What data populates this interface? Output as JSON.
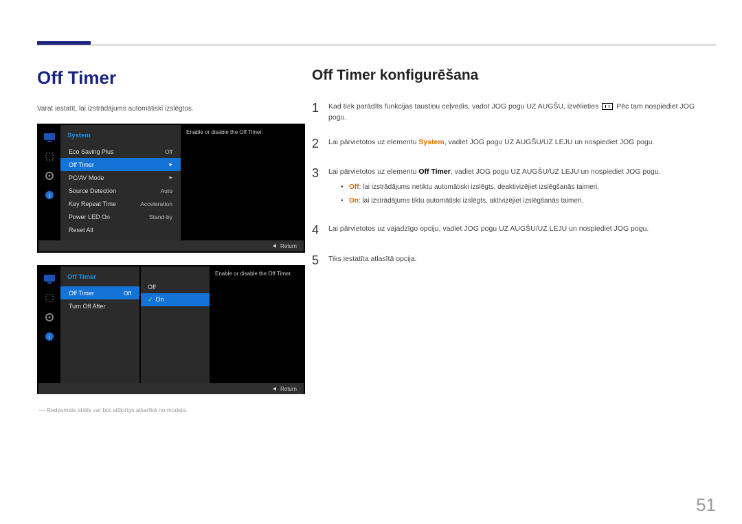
{
  "page_number": "51",
  "left": {
    "title": "Off Timer",
    "intro": "Varat iestatīt, lai izstrādājums automātiski izslēgtos.",
    "footnote": "― Redzamais attēls var būt atšķirīgs atkarībā no modeļa."
  },
  "osd1": {
    "menu_title": "System",
    "help": "Enable or disable the Off Timer.",
    "return": "Return",
    "items": {
      "eco": {
        "label": "Eco Saving Plus",
        "value": "Off"
      },
      "off_timer": {
        "label": "Off Timer"
      },
      "pcav": {
        "label": "PC/AV Mode"
      },
      "source": {
        "label": "Source Detection",
        "value": "Auto"
      },
      "keyrepeat": {
        "label": "Key Repeat Time",
        "value": "Acceleration"
      },
      "powerled": {
        "label": "Power LED On",
        "value": "Stand-by"
      },
      "resetall": {
        "label": "Reset All"
      }
    }
  },
  "osd2": {
    "menu_title": "Off Timer",
    "help": "Enable or disable the Off Timer.",
    "return": "Return",
    "items": {
      "off_timer": {
        "label": "Off Timer",
        "value": "Off"
      },
      "turn_off_after": {
        "label": "Turn Off After"
      }
    },
    "options": {
      "off": "Off",
      "on": "On"
    }
  },
  "right": {
    "title": "Off Timer konfigurēšana",
    "steps": {
      "s1": {
        "pre": "Kad tiek parādīts funkcijas taustiņu ceļvedis, vadot JOG pogu UZ AUGŠU, izvēlieties ",
        "post": " Pēc tam nospiediet JOG pogu."
      },
      "s2": {
        "a": "Lai pārvietotos uz elementu ",
        "b": "System",
        "c": ", vadiet JOG pogu UZ AUGŠU/UZ LEJU un nospiediet JOG pogu."
      },
      "s3": {
        "a": "Lai pārvietotos uz elementu ",
        "b": "Off Timer",
        "c": ", vadiet JOG pogu UZ AUGŠU/UZ LEJU un nospiediet JOG pogu.",
        "off_a": "Off",
        "off_b": ": lai izstrādājums netiktu automātiski izslēgts, deaktivizējiet izslēgšanās taimeri.",
        "on_a": "On",
        "on_b": ": lai izstrādājums tiktu automātiski izslēgts, aktivizējiet izslēgšanās taimeri."
      },
      "s4": "Lai pārvietotos uz vajadzīgo opciju, vadiet JOG pogu UZ AUGŠU/UZ LEJU un nospiediet JOG pogu.",
      "s5": "Tiks iestatīta atlasītā opcija."
    }
  }
}
